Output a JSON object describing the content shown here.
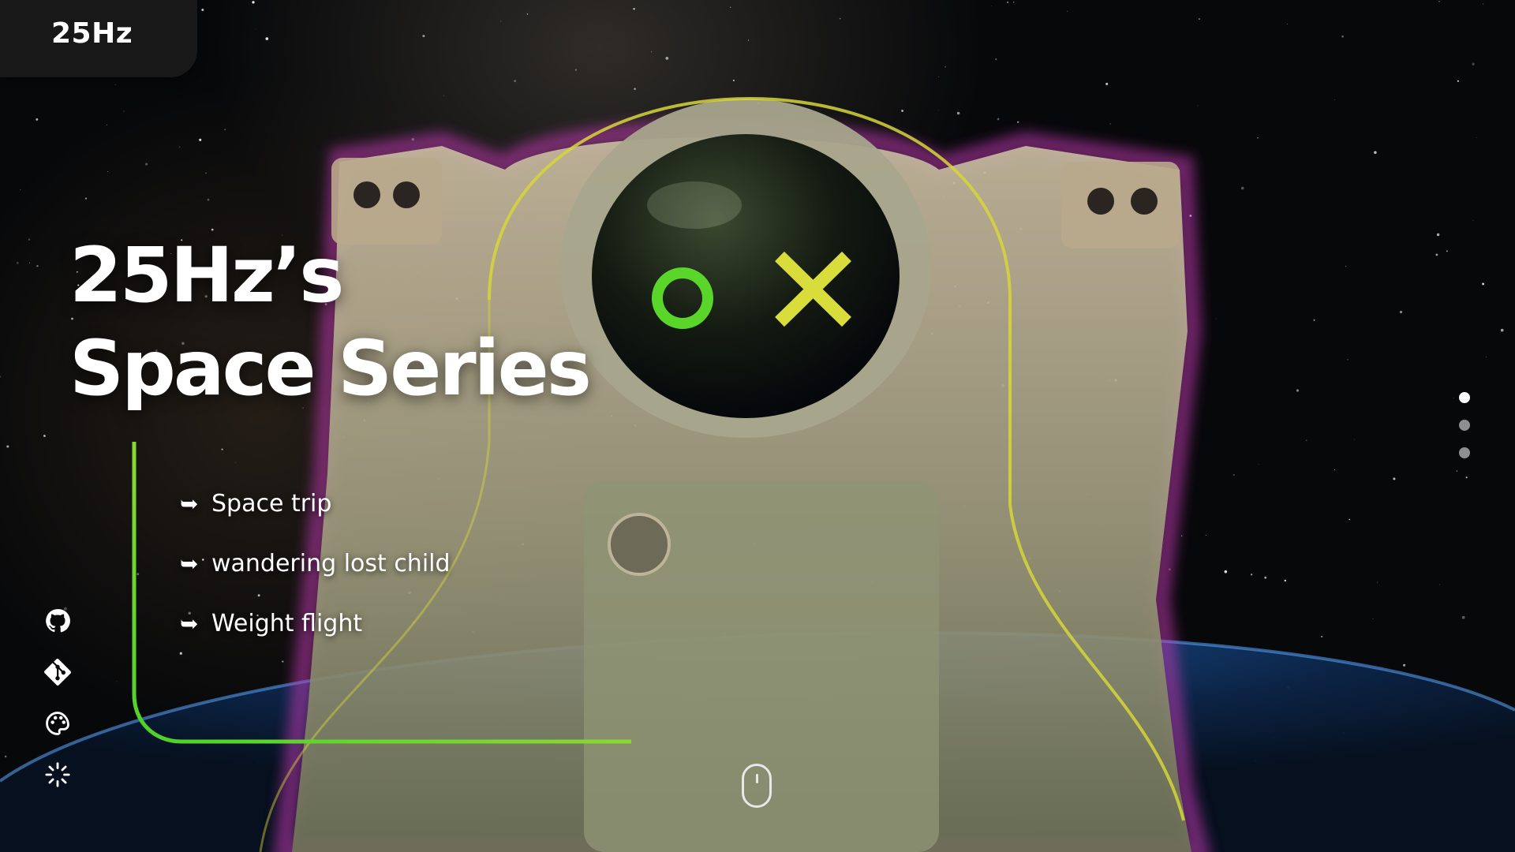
{
  "brand": {
    "name": "25Hz"
  },
  "hero": {
    "title_line1": "25Hz’s",
    "title_line2": "Space Series"
  },
  "features": [
    {
      "arrow": "➥",
      "label": "Space trip"
    },
    {
      "arrow": "➥",
      "label": "wandering lost child"
    },
    {
      "arrow": "➥",
      "label": "Weight flight"
    }
  ],
  "hero_visual": {
    "subject": "astronaut",
    "visor_symbols": [
      "o",
      "x"
    ]
  },
  "social": [
    {
      "icon": "github-icon"
    },
    {
      "icon": "git-icon"
    },
    {
      "icon": "palette-icon"
    },
    {
      "icon": "loader-icon"
    }
  ],
  "pager": {
    "total": 3,
    "active": 1
  },
  "colors": {
    "accent_green": "#5ad62a",
    "accent_yellow": "#d9dd3c",
    "glow_magenta": "#c23ab4",
    "brand_tab_bg": "#1e1e1e"
  }
}
